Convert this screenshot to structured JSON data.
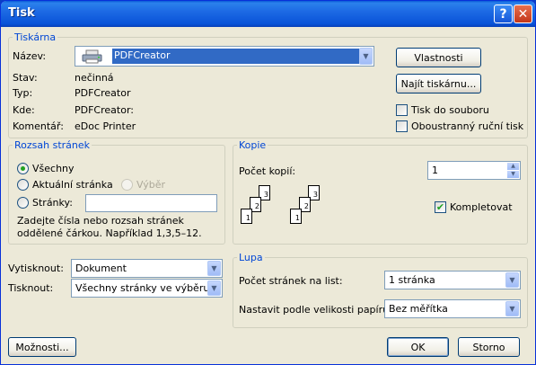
{
  "window": {
    "title": "Tisk",
    "help_glyph": "?",
    "close_glyph": "✕"
  },
  "printer": {
    "legend": "Tiskárna",
    "name_label": "Název:",
    "name_value": "PDFCreator",
    "status_label": "Stav:",
    "status_value": "nečinná",
    "type_label": "Typ:",
    "type_value": "PDFCreator",
    "where_label": "Kde:",
    "where_value": "PDFCreator:",
    "comment_label": "Komentář:",
    "comment_value": "eDoc Printer",
    "properties_button": "Vlastnosti",
    "find_button": "Najít tiskárnu...",
    "print_to_file": {
      "label": "Tisk do souboru",
      "checked": false
    },
    "manual_duplex": {
      "label": "Oboustranný ruční tisk",
      "checked": false
    }
  },
  "range": {
    "legend": "Rozsah stránek",
    "all": "Všechny",
    "current": "Aktuální stránka",
    "selection": "Výběr",
    "pages": "Stránky:",
    "pages_value": "",
    "selected": "Všechny",
    "hint": "Zadejte čísla nebo rozsah stránek oddělené čárkou. Například 1,3,5–12."
  },
  "copies": {
    "legend": "Kopie",
    "count_label": "Počet kopií:",
    "count_value": "1",
    "collate": {
      "label": "Kompletovat",
      "checked": true
    },
    "stack_pages": [
      "1",
      "2",
      "3"
    ]
  },
  "print_what": {
    "label": "Vytisknout:",
    "value": "Dokument"
  },
  "print": {
    "label": "Tisknout:",
    "value": "Všechny stránky ve výběru"
  },
  "zoom": {
    "legend": "Lupa",
    "pages_per_sheet_label": "Počet stránek na list:",
    "pages_per_sheet_value": "1 stránka",
    "scale_label": "Nastavit podle velikosti papíru:",
    "scale_value": "Bez měřítka"
  },
  "buttons": {
    "options": "Možnosti...",
    "ok": "OK",
    "cancel": "Storno"
  }
}
